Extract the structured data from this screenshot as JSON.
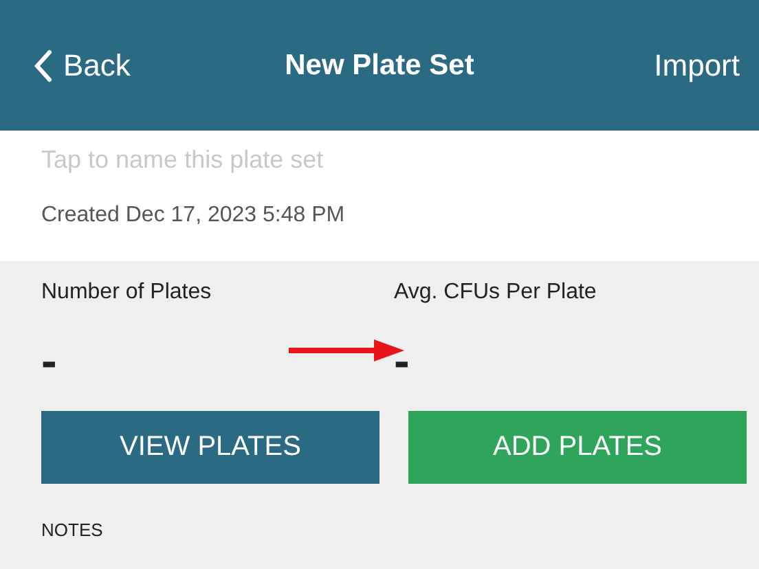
{
  "nav_bar": {
    "back": "Back",
    "title": "New Plate Set",
    "action": "Import"
  },
  "name_field": {
    "placeholder": "Tap to name this plate set"
  },
  "created": "Created Dec 17, 2023 5:48 PM",
  "stats": [
    {
      "label": "Number of Plates",
      "value": "-"
    },
    {
      "label": "Avg. CFUs Per Plate",
      "value": "-"
    }
  ],
  "buttons": [
    {
      "label": "VIEW PLATES",
      "kind": "primary"
    },
    {
      "label": "ADD PLATES",
      "kind": "success"
    }
  ],
  "notes_label": "NOTES"
}
